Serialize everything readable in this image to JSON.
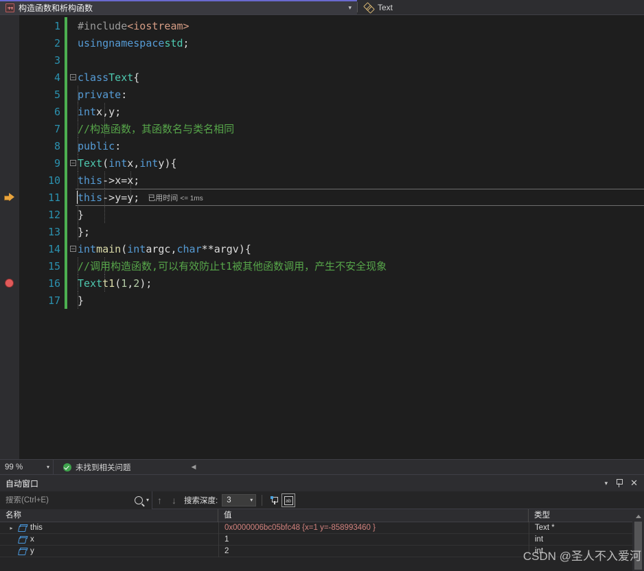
{
  "tab": {
    "icon": "cpp-file-icon",
    "title": "构造函数和析构函数",
    "caret": "▾",
    "right_icon": "properties-icon",
    "right_label": "Text"
  },
  "editor": {
    "lines": [
      {
        "n": "1",
        "text": "#include <iostream>"
      },
      {
        "n": "2",
        "text": "using namespace std;"
      },
      {
        "n": "3",
        "text": ""
      },
      {
        "n": "4",
        "text": "class Text {"
      },
      {
        "n": "5",
        "text": "private:"
      },
      {
        "n": "6",
        "text": "    int x, y;"
      },
      {
        "n": "7",
        "text": "    //构造函数，其函数名与类名相同"
      },
      {
        "n": "8",
        "text": "public:"
      },
      {
        "n": "9",
        "text": "    Text(int x, int y) {"
      },
      {
        "n": "10",
        "text": "        this->x = x;"
      },
      {
        "n": "11",
        "text": "        this->y = y;"
      },
      {
        "n": "12",
        "text": "    }"
      },
      {
        "n": "13",
        "text": "};"
      },
      {
        "n": "14",
        "text": "int main(int argc, char** argv) {"
      },
      {
        "n": "15",
        "text": "    //调用构造函数,可以有效防止t1被其他函数调用，产生不安全现象"
      },
      {
        "n": "16",
        "text": "    Text t1(1,2);"
      },
      {
        "n": "17",
        "text": "}"
      }
    ],
    "elapsed_label": "已用时间",
    "elapsed_value": "<= 1ms",
    "current_line": "11",
    "breakpoint_line": "16"
  },
  "status_bar": {
    "zoom": "99 %",
    "zoom_caret": "▾",
    "problems_icon": "check-circle-icon",
    "problems_text": "未找到相关问题",
    "nav_back": "◀"
  },
  "autos": {
    "title": "自动窗口",
    "title_caret": "▾",
    "pin_icon": "pin-icon",
    "close_icon": "close-icon",
    "search_placeholder": "搜索(Ctrl+E)",
    "search_value": "",
    "search_icon": "magnifier-icon",
    "search_caret": "▾",
    "up_arrow": "↑",
    "down_arrow": "↓",
    "depth_label": "搜索深度:",
    "depth_value": "3",
    "depth_caret": "▾",
    "pin_toggle_icon": "pin-filter-icon",
    "hex_toggle_icon": "ab-box-icon",
    "columns": [
      "名称",
      "值",
      "类型"
    ],
    "rows": [
      {
        "expander": "▸",
        "icon": "variable-icon",
        "name": "this",
        "value": "0x0000006bc05bfc48 {x=1 y=-858993460 }",
        "type": "Text *",
        "value_is_pointer": true
      },
      {
        "expander": "",
        "icon": "variable-icon",
        "name": "x",
        "value": "1",
        "type": "int",
        "value_is_pointer": false
      },
      {
        "expander": "",
        "icon": "variable-icon",
        "name": "y",
        "value": "2",
        "type": "int",
        "value_is_pointer": false
      }
    ],
    "scroll_up_icon": "scroll-up-icon"
  },
  "watermark": "CSDN @圣人不入爱河",
  "colors": {
    "editor_bg": "#1e1e1e",
    "chrome_bg": "#2d2d30",
    "keyword": "#569cd6",
    "type": "#4ec9b0",
    "comment": "#57a64a",
    "string": "#d69d85",
    "number": "#b5cea8",
    "function": "#dcdcaa",
    "line_number": "#2b91af",
    "change_bar": "#4caf50",
    "breakpoint": "#e05a5a",
    "exec_arrow": "#e8a33d",
    "pointer_value": "#d4837f"
  }
}
